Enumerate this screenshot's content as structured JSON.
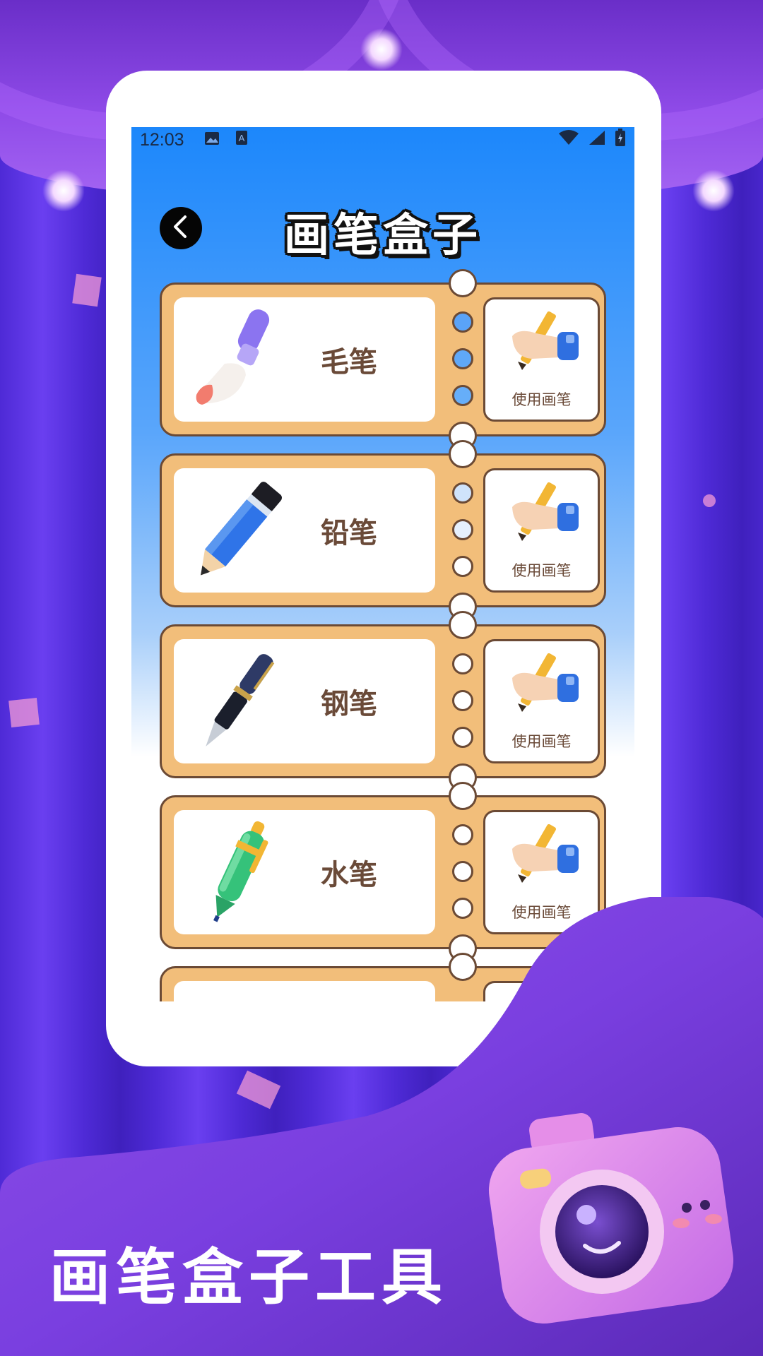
{
  "status_bar": {
    "time": "12:03",
    "left_icons": [
      "image-icon",
      "keyboard-a-icon"
    ],
    "right_icons": [
      "wifi-icon",
      "cellular-icon",
      "battery-icon"
    ]
  },
  "header": {
    "title": "画笔盒子",
    "back_icon": "chevron-left-icon"
  },
  "pens": [
    {
      "name": "毛笔",
      "icon": "brush-icon",
      "action_label": "使用画笔"
    },
    {
      "name": "铅笔",
      "icon": "pencil-icon",
      "action_label": "使用画笔"
    },
    {
      "name": "钢笔",
      "icon": "fountain-pen-icon",
      "action_label": "使用画笔"
    },
    {
      "name": "水笔",
      "icon": "gel-pen-icon",
      "action_label": "使用画笔"
    }
  ],
  "promo": {
    "title": "画笔盒子工具",
    "camera_icon": "camera-icon"
  },
  "colors": {
    "ticket": "#f2be7a",
    "ticket_border": "#6b4a35",
    "text_brown": "#6a4a38",
    "screen_top": "#1c87fb",
    "background_purple": "#5a2fc8"
  }
}
